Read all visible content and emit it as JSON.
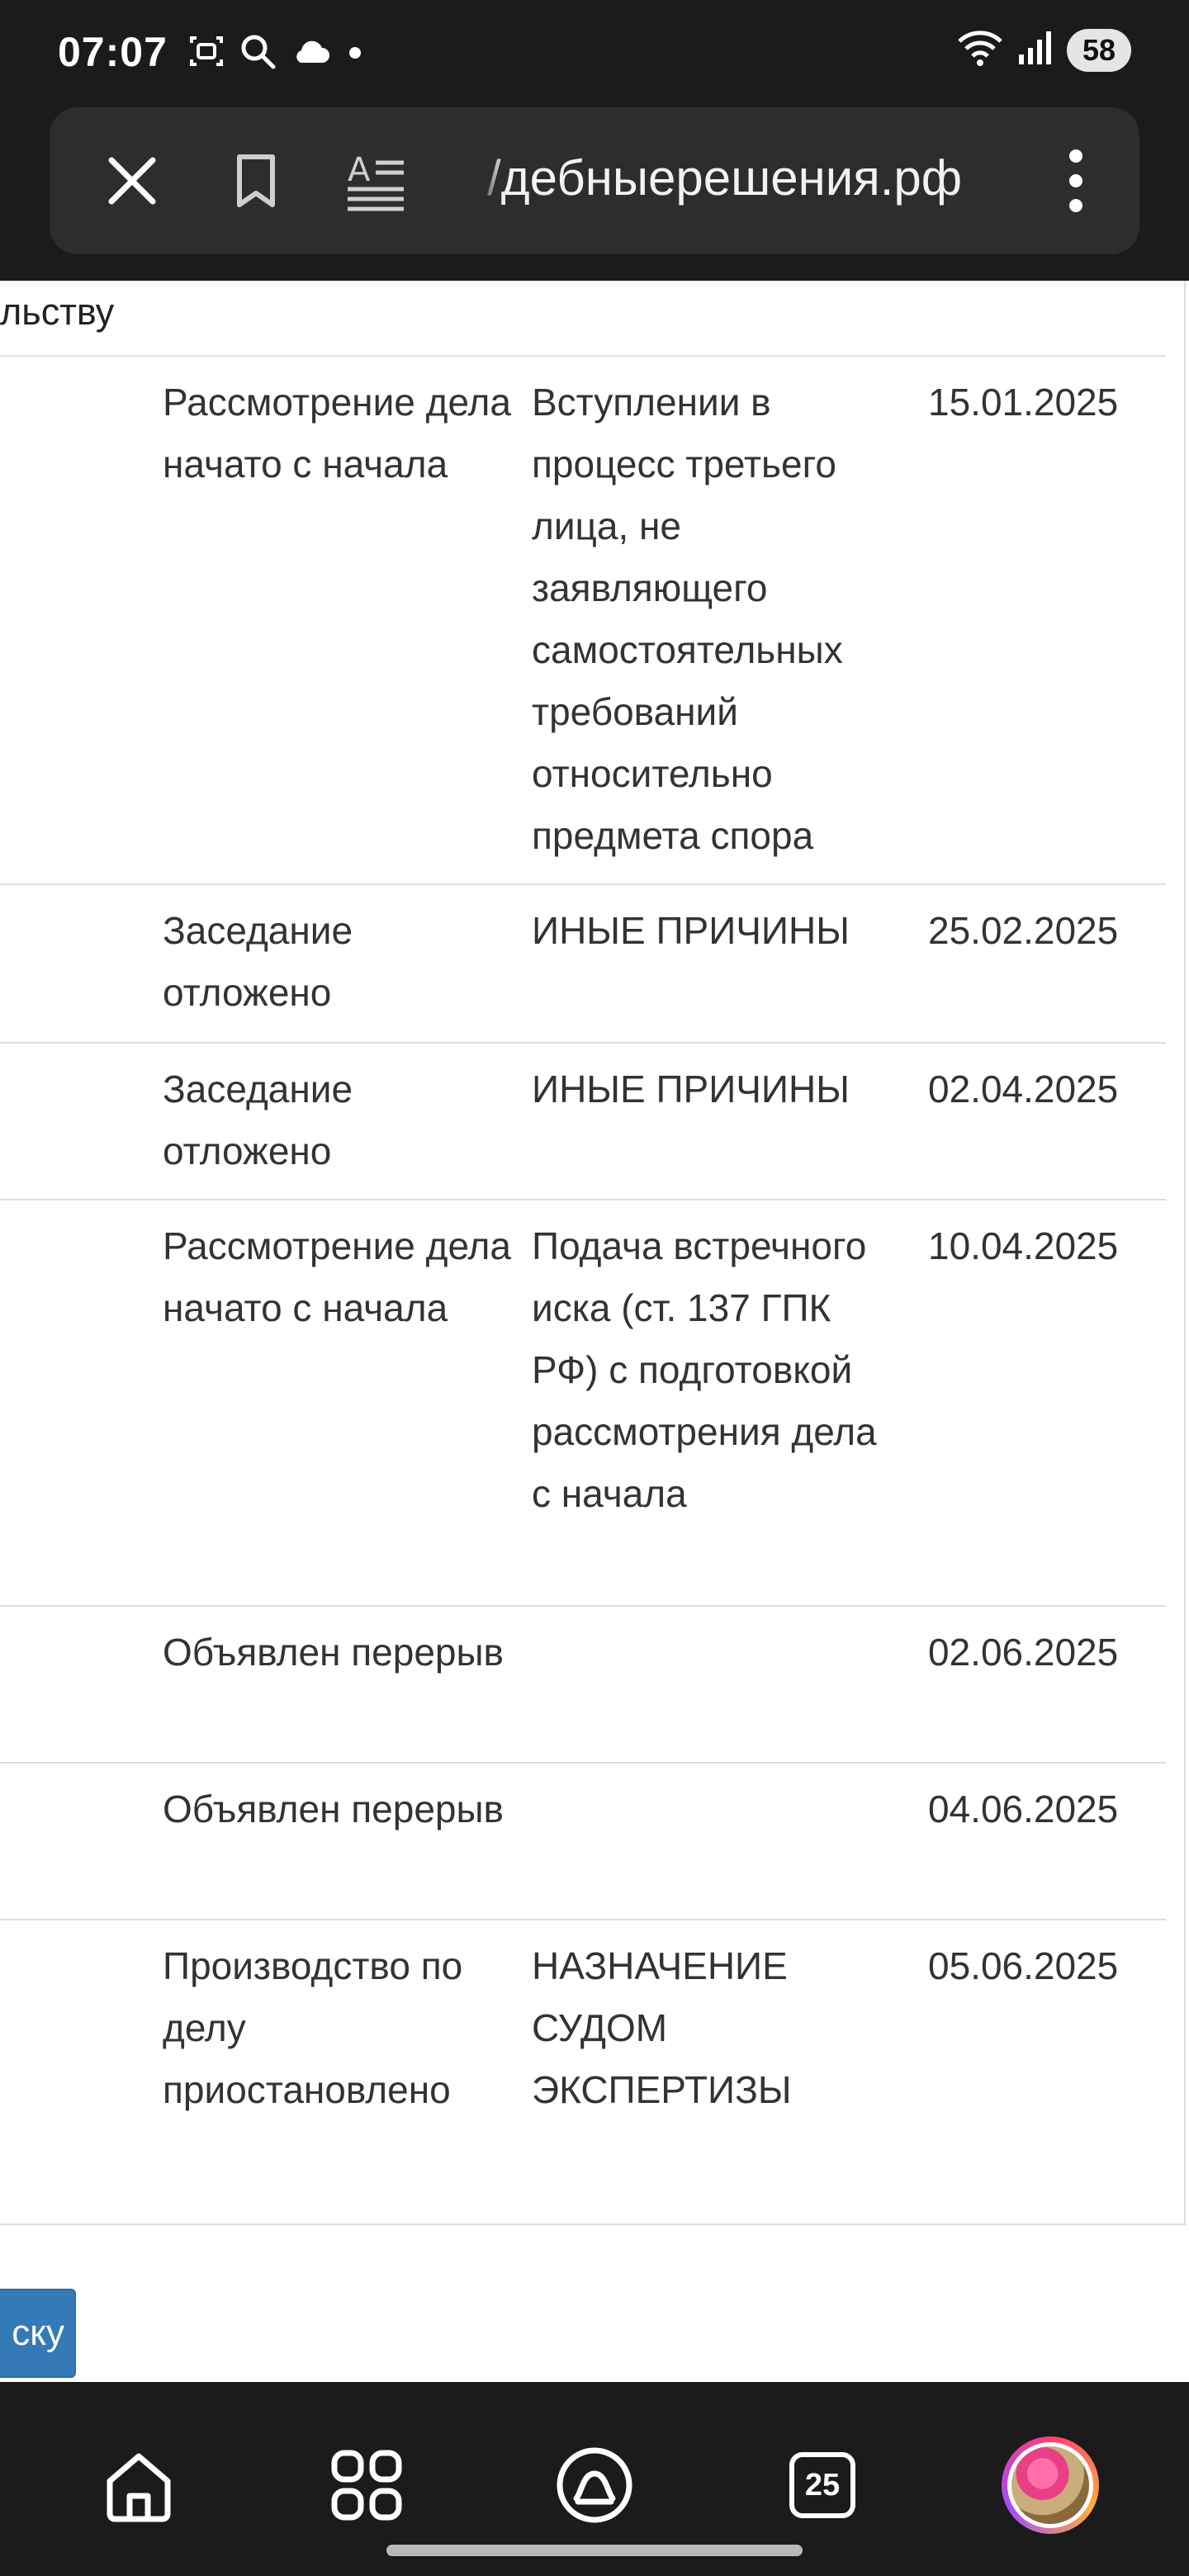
{
  "status_bar": {
    "time": "07:07",
    "icons_left": [
      "screenshot-icon",
      "search-icon",
      "cloud-icon",
      "dot-icon"
    ],
    "icons_right": [
      "wifi-icon",
      "signal-icon"
    ],
    "battery": "58"
  },
  "browser": {
    "url": "/дебныерешения.рф",
    "buttons": [
      "close-icon",
      "bookmark-icon",
      "reader-mode-icon",
      "more-icon"
    ]
  },
  "table": {
    "top_fragment": "льству",
    "rows": [
      {
        "event": "Рассмотрение дела начато с начала",
        "reason": "Вступлении в процесс третьего лица, не заявляющего самостоятельных требований относительно предмета спора",
        "date": "15.01.2025"
      },
      {
        "event": "Заседание отложено",
        "reason": "ИНЫЕ ПРИЧИНЫ",
        "date": "25.02.2025"
      },
      {
        "event": "Заседание отложено",
        "reason": "ИНЫЕ ПРИЧИНЫ",
        "date": "02.04.2025"
      },
      {
        "event": "Рассмотрение дела начато с начала",
        "reason": "Подача встречного иска (ст. 137 ГПК РФ) с подготовкой рассмотрения дела с начала",
        "date": "10.04.2025"
      },
      {
        "event": "Объявлен перерыв",
        "reason": "",
        "date": "02.06.2025"
      },
      {
        "event": "Объявлен перерыв",
        "reason": "",
        "date": "04.06.2025"
      },
      {
        "event": "Производство по делу приостановлено",
        "reason": "НАЗНАЧЕНИЕ СУДОМ ЭКСПЕРТИЗЫ",
        "date": "05.06.2025"
      }
    ]
  },
  "action_button": {
    "label": "ску"
  },
  "bottom_nav": {
    "items": [
      "home-icon",
      "apps-icon",
      "assistant-icon",
      "tabs-icon",
      "profile-avatar"
    ],
    "tabs_count": "25"
  },
  "colors": {
    "button_blue": "#337ab7",
    "dark_bar": "#1b1b1b"
  }
}
